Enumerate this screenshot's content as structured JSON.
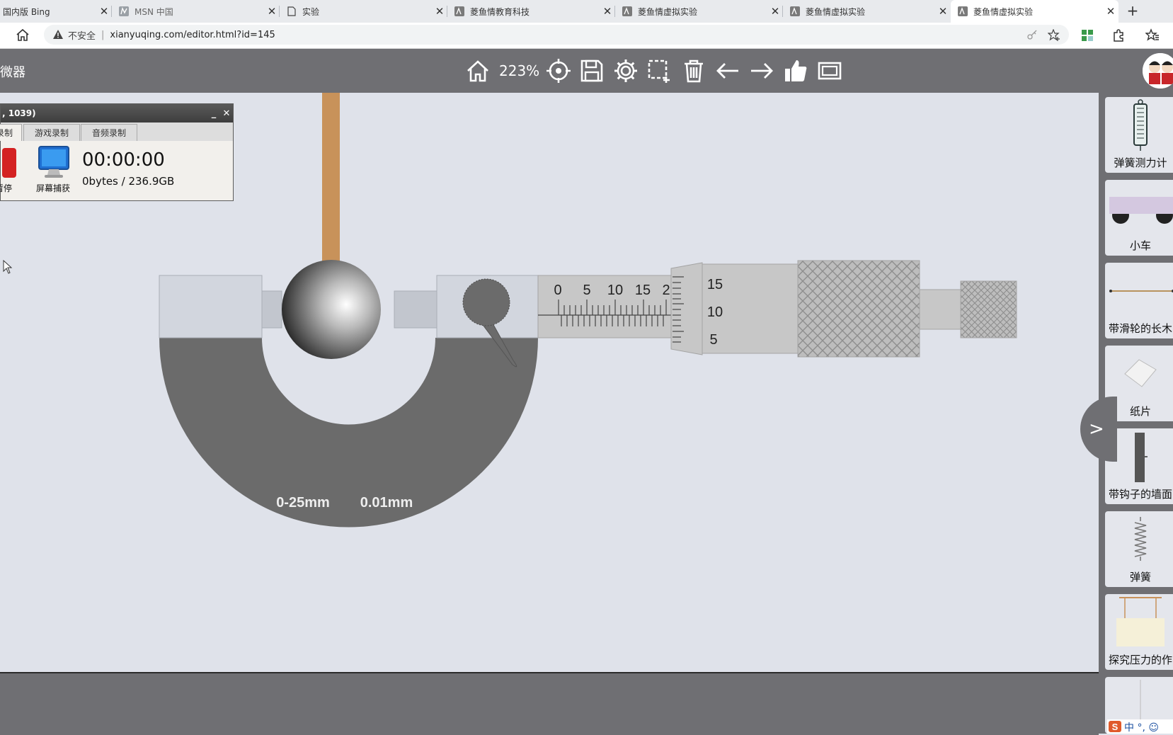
{
  "browser": {
    "tabs": [
      {
        "label": "国内版 Bing",
        "active": false
      },
      {
        "label": "MSN 中国",
        "active": false
      },
      {
        "label": "实验",
        "active": false
      },
      {
        "label": "菱鱼情教育科技",
        "active": false
      },
      {
        "label": "菱鱼情虚拟实验",
        "active": false
      },
      {
        "label": "菱鱼情虚拟实验",
        "active": false
      },
      {
        "label": "菱鱼情虚拟实验",
        "active": true
      }
    ],
    "close_glyph": "✕",
    "new_tab_glyph": "+",
    "security_text": "不安全",
    "url": "xianyuqing.com/editor.html?id=145",
    "url_separator": "|"
  },
  "app": {
    "title": "微器",
    "zoom": "223%",
    "toolbar_icons": [
      "home-icon",
      "locate-icon",
      "save-icon",
      "settings-icon",
      "select-area-icon",
      "delete-icon",
      "undo-icon",
      "redo-icon",
      "like-icon",
      "fullscreen-icon"
    ]
  },
  "recorder": {
    "title": ", 1039)",
    "minimize_glyph": "_",
    "close_glyph": "✕",
    "tabs": [
      "录制",
      "游戏录制",
      "音频录制"
    ],
    "timer": "00:00:00",
    "bytes": "0bytes / 236.9GB",
    "capture_label": "屏幕捕获",
    "pause_label": "暂停"
  },
  "micrometer": {
    "range_label": "0-25mm",
    "precision_label": "0.01mm",
    "main_scale_labels": [
      "0",
      "5",
      "10",
      "15",
      "2"
    ],
    "thimble_labels": [
      "15",
      "10",
      "5"
    ],
    "colors": {
      "frame": "#6b6b6b",
      "body": "#d2d6de",
      "barrel": "#c7c7c7",
      "string": "#c8925a"
    }
  },
  "panel": {
    "items": [
      {
        "label": "弹簧测力计"
      },
      {
        "label": "小车"
      },
      {
        "label": "带滑轮的长木"
      },
      {
        "label": "纸片"
      },
      {
        "label": "带钩子的墙面"
      },
      {
        "label": "弹簧"
      },
      {
        "label": "探究压力的作"
      },
      {
        "label": ""
      }
    ],
    "expand_glyph": ">"
  },
  "ime": {
    "text": "中 °, ☺"
  }
}
